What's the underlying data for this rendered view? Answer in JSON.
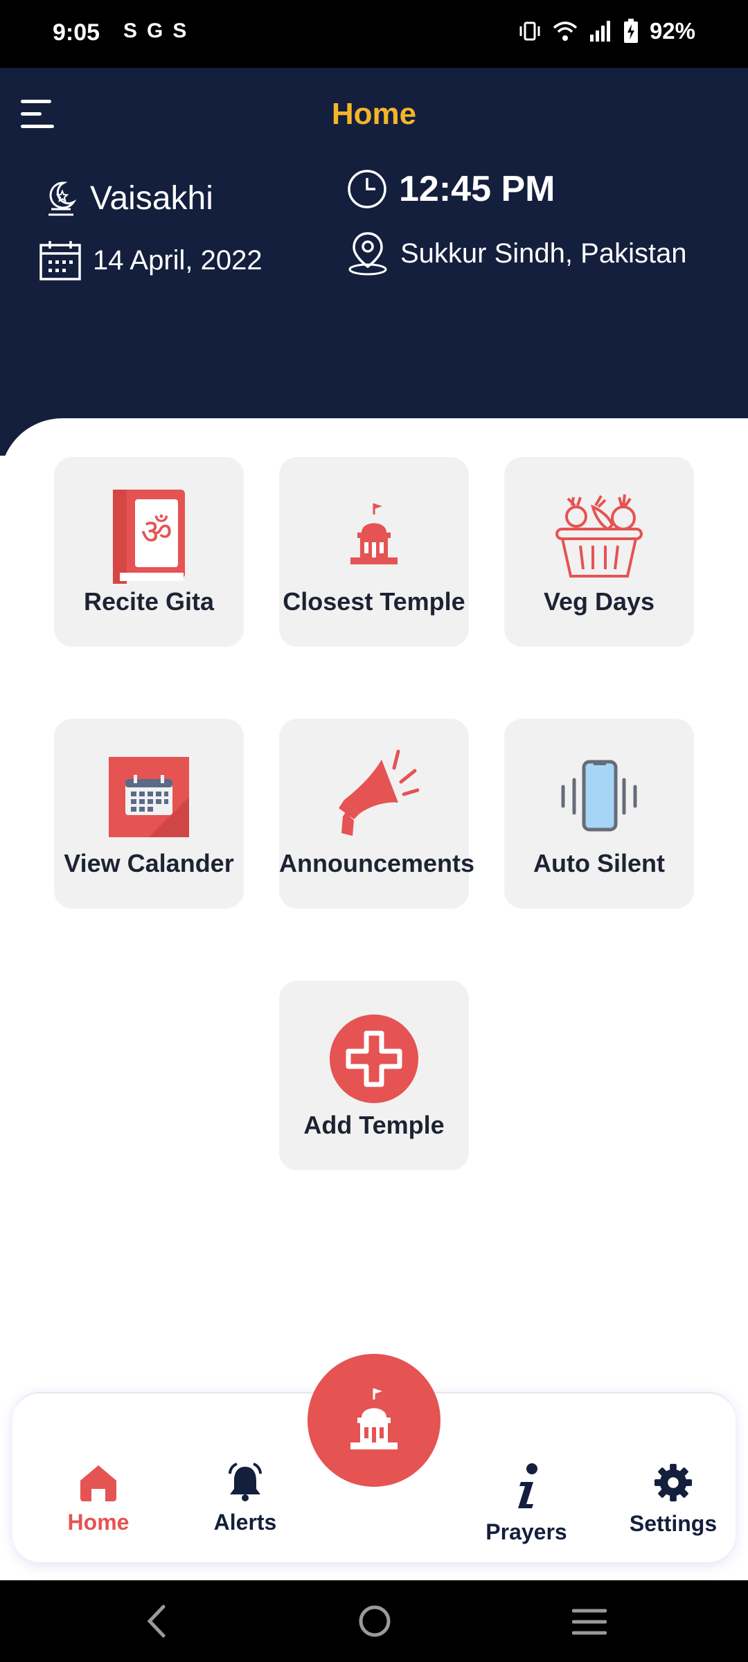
{
  "status_bar": {
    "time": "9:05",
    "left_icons": [
      "S",
      "G",
      "S"
    ],
    "battery": "92%"
  },
  "header": {
    "title": "Home",
    "festival": "Vaisakhi",
    "date": "14 April, 2022",
    "time": "12:45 PM",
    "location": "Sukkur Sindh, Pakistan"
  },
  "tiles": {
    "recite_gita": "Recite Gita",
    "closest_temple": "Closest Temple",
    "veg_days": "Veg Days",
    "view_calendar": "View Calander",
    "announcements": "Announcements",
    "auto_silent": "Auto Silent",
    "add_temple": "Add Temple"
  },
  "bottom_nav": {
    "home": "Home",
    "alerts": "Alerts",
    "prayers": "Prayers",
    "settings": "Settings"
  },
  "colors": {
    "header_bg": "#141f3d",
    "accent_title": "#f5b52a",
    "brand_red": "#e55353",
    "tile_bg": "#f1f1f1"
  },
  "icons": [
    "menu-icon",
    "moon-star-icon",
    "calendar-icon",
    "clock-icon",
    "location-pin-icon",
    "om-book-icon",
    "temple-icon",
    "vegetable-basket-icon",
    "calendar-grid-icon",
    "megaphone-icon",
    "vibrating-phone-icon",
    "plus-icon",
    "home-icon",
    "bell-icon",
    "info-icon",
    "gear-icon",
    "back-icon",
    "circle-home-icon",
    "recents-icon"
  ]
}
